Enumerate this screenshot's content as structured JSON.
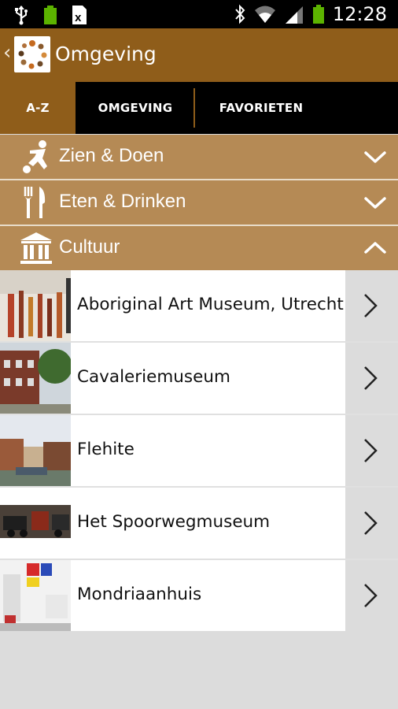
{
  "status_bar": {
    "time": "12:28",
    "icons": [
      "usb-icon",
      "battery-full-icon",
      "excel-icon",
      "bluetooth-icon",
      "wifi-icon",
      "signal-icon",
      "battery-icon"
    ]
  },
  "action_bar": {
    "title": "Omgeving",
    "back_icon": "back-chevron-icon",
    "logo_icon": "app-logo-icon"
  },
  "tabs": [
    {
      "label": "A-Z",
      "active": true
    },
    {
      "label": "OMGEVING",
      "active": false
    },
    {
      "label": "FAVORIETEN",
      "active": false
    }
  ],
  "categories": [
    {
      "label": "Zien & Doen",
      "icon": "sports-icon",
      "expanded": false
    },
    {
      "label": "Eten & Drinken",
      "icon": "fork-knife-icon",
      "expanded": false
    },
    {
      "label": "Cultuur",
      "icon": "museum-icon",
      "expanded": true
    }
  ],
  "items": [
    {
      "label": "Aboriginal Art Museum, Utrecht"
    },
    {
      "label": "Cavaleriemuseum"
    },
    {
      "label": "Flehite"
    },
    {
      "label": "Het Spoorwegmuseum"
    },
    {
      "label": "Mondriaanhuis"
    }
  ],
  "colors": {
    "brand": "#8f5d1a",
    "category_bg": "#b58a55",
    "page_bg": "#dcdcdc"
  }
}
